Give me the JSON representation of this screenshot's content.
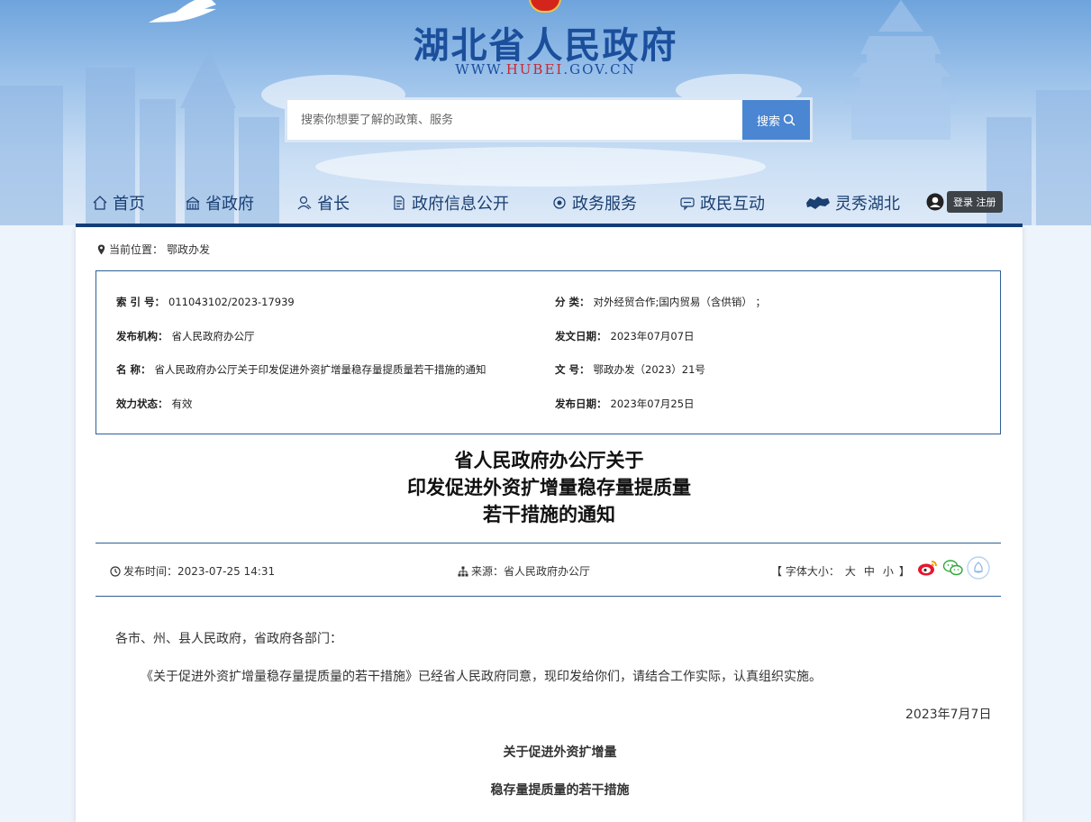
{
  "header": {
    "site_title": "湖北省人民政府",
    "url_prefix": "WWW.",
    "url_domain": "HUBEI",
    "url_suffix": ".GOV.CN",
    "search": {
      "placeholder": "搜索你想要了解的政策、服务",
      "button_label": "搜索"
    }
  },
  "nav": {
    "items": [
      {
        "label": "首页",
        "icon": "home-icon"
      },
      {
        "label": "省政府",
        "icon": "building-icon"
      },
      {
        "label": "省长",
        "icon": "person-icon"
      },
      {
        "label": "政府信息公开",
        "icon": "document-icon"
      },
      {
        "label": "政务服务",
        "icon": "service-icon"
      },
      {
        "label": "政民互动",
        "icon": "chat-icon"
      },
      {
        "label": "灵秀湖北",
        "icon": "hubei-map-icon"
      }
    ],
    "login_label": "登录 注册"
  },
  "breadcrumb": {
    "label": "当前位置：",
    "current": "鄂政办发"
  },
  "meta": {
    "index_key": "索 引 号：",
    "index_value": "011043102/2023-17939",
    "category_key": "分 类：",
    "category_value": "对外经贸合作;国内贸易（含供销）  ；",
    "publisher_key": "发布机构：",
    "publisher_value": "省人民政府办公厅",
    "issue_date_key": "发文日期：",
    "issue_date_value": "2023年07月07日",
    "name_key": "名 称：",
    "name_value": "省人民政府办公厅关于印发促进外资扩增量稳存量提质量若干措施的通知",
    "doc_no_key": "文 号：",
    "doc_no_value": "鄂政办发（2023）21号",
    "status_key": "效力状态：",
    "status_value": "有效",
    "publish_date_key": "发布日期：",
    "publish_date_value": "2023年07月25日"
  },
  "article": {
    "title_line1": "省人民政府办公厅关于",
    "title_line2": "印发促进外资扩增量稳存量提质量",
    "title_line3": "若干措施的通知",
    "publish_time": "发布时间：2023-07-25 14:31",
    "source": "来源：省人民政府办公厅",
    "font_size_label": "【 字体大小：",
    "font_sizes": [
      "大",
      "中",
      "小"
    ],
    "font_size_close": "】",
    "salutation": "各市、州、县人民政府，省政府各部门：",
    "paragraph1": "《关于促进外资扩增量稳存量提质量的若干措施》已经省人民政府同意，现印发给你们，请结合工作实际，认真组织实施。",
    "date": "2023年7月7日",
    "sub_title1": "关于促进外资扩增量",
    "sub_title2": "稳存量提质量的若干措施"
  },
  "colors": {
    "brand_blue": "#1b4f9c",
    "nav_border": "#143f7c",
    "url_red": "#c9282d",
    "search_button": "#4a86d1"
  }
}
